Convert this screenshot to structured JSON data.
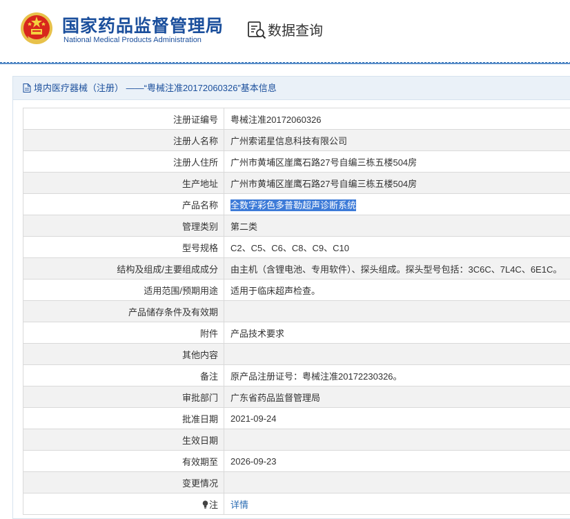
{
  "header": {
    "brand_cn": "国家药品监督管理局",
    "brand_en": "National Medical Products Administration",
    "query_title": "数据查询"
  },
  "panel": {
    "title": "境内医疗器械（注册） ——“粤械注准20172060326”基本信息"
  },
  "rows": [
    {
      "label": "注册证编号",
      "value": "粤械注准20172060326"
    },
    {
      "label": "注册人名称",
      "value": "广州索诺星信息科技有限公司"
    },
    {
      "label": "注册人住所",
      "value": "广州市黄埔区崖鹰石路27号自编三栋五楼504房"
    },
    {
      "label": "生产地址",
      "value": "广州市黄埔区崖鹰石路27号自编三栋五楼504房"
    },
    {
      "label": "产品名称",
      "value": "全数字彩色多普勒超声诊断系统"
    },
    {
      "label": "管理类别",
      "value": "第二类"
    },
    {
      "label": "型号规格",
      "value": "C2、C5、C6、C8、C9、C10"
    },
    {
      "label": "结构及组成/主要组成成分",
      "value": "由主机（含锂电池、专用软件）、探头组成。探头型号包括：3C6C、7L4C、6E1C。"
    },
    {
      "label": "适用范围/预期用途",
      "value": "适用于临床超声检查。"
    },
    {
      "label": "产品储存条件及有效期",
      "value": ""
    },
    {
      "label": "附件",
      "value": "产品技术要求"
    },
    {
      "label": "其他内容",
      "value": ""
    },
    {
      "label": "备注",
      "value": "原产品注册证号：粤械注准20172230326。"
    },
    {
      "label": "审批部门",
      "value": "广东省药品监督管理局"
    },
    {
      "label": "批准日期",
      "value": "2021-09-24"
    },
    {
      "label": "生效日期",
      "value": ""
    },
    {
      "label": "有效期至",
      "value": "2026-09-23"
    },
    {
      "label": "变更情况",
      "value": ""
    },
    {
      "label": "注",
      "value": "详情"
    }
  ],
  "colors": {
    "brand_blue": "#1b4f9c",
    "panel_head_bg": "#eaf1f8",
    "highlight": "#3d7bd8",
    "link": "#2a6cb3"
  },
  "icons": {
    "emblem": "national-emblem-icon",
    "query": "document-search-icon",
    "panel": "document-icon",
    "note": "lightbulb-icon"
  }
}
